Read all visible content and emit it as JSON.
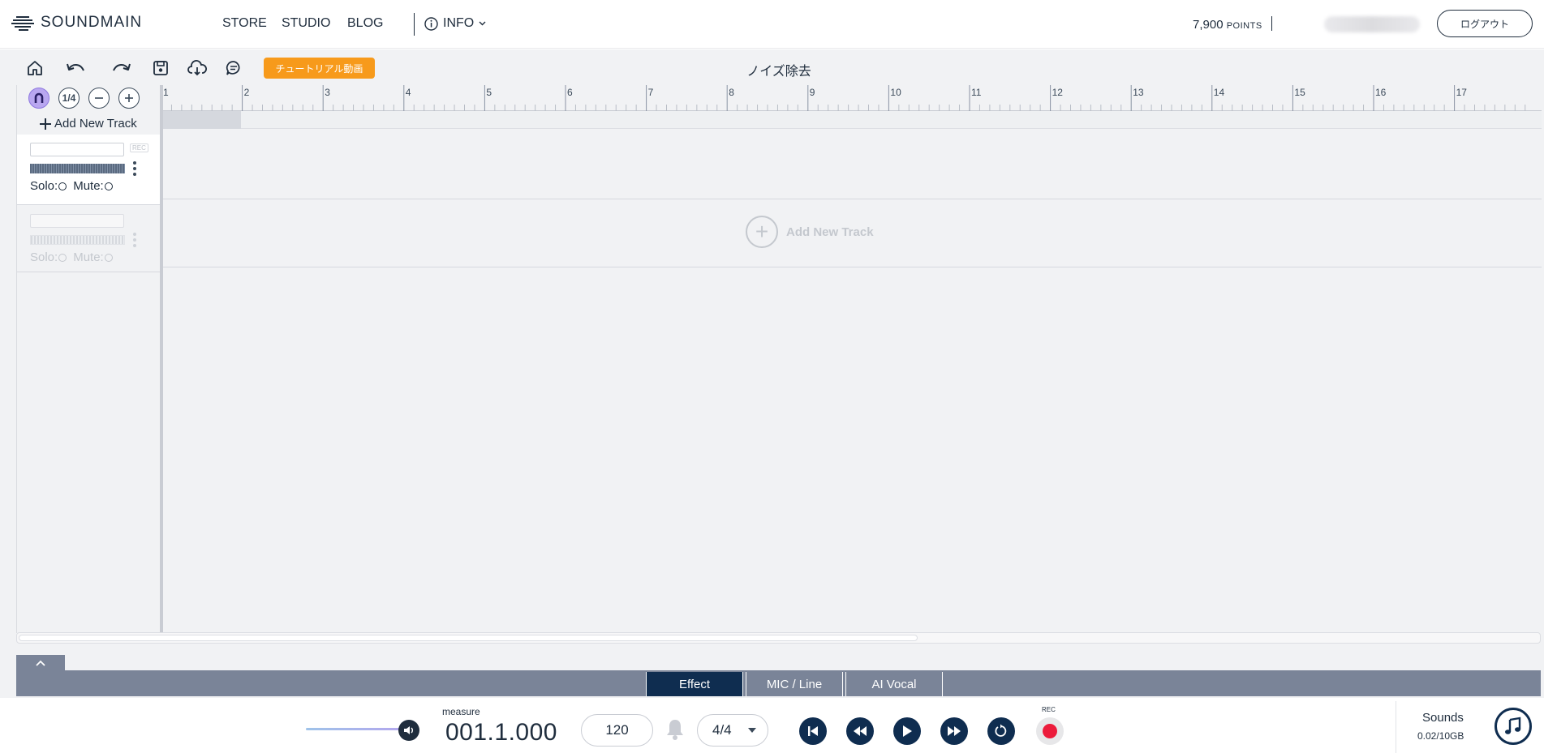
{
  "nav": {
    "logo_text": "SOUNDMAIN",
    "links": [
      "STORE",
      "STUDIO",
      "BLOG"
    ],
    "info_label": "INFO",
    "points_value": "7,900",
    "points_unit": "POINTS",
    "logout_label": "ログアウト"
  },
  "toolbar": {
    "tutorial_label": "チュートリアル動画",
    "project_title": "ノイズ除去",
    "icons": [
      "home-icon",
      "undo-icon",
      "redo-icon",
      "save-icon",
      "cloud-download-icon",
      "comment-icon"
    ]
  },
  "tracks_panel": {
    "quantize_label": "1/4",
    "add_track_label": "Add New Track",
    "rec_badge": "REC",
    "solo_label": "Solo:",
    "mute_label": "Mute:"
  },
  "timeline": {
    "bar_numbers": [
      "1",
      "2",
      "3",
      "4",
      "5",
      "6",
      "7",
      "8",
      "9",
      "10",
      "11",
      "12",
      "13",
      "14",
      "15",
      "16",
      "17"
    ],
    "add_track_label": "Add New Track"
  },
  "bottom_tabs": [
    "Effect",
    "MIC / Line",
    "AI Vocal"
  ],
  "active_tab": "Effect",
  "transport": {
    "measure_label": "measure",
    "measure_value": "001.1.000",
    "tempo": "120",
    "time_signature": "4/4",
    "rec_label": "REC"
  },
  "sounds": {
    "label": "Sounds",
    "usage": "0.02/10GB"
  },
  "colors": {
    "navy": "#0f2d50",
    "accent_orange": "#f79a1b",
    "rec_red": "#ec1b3b",
    "panel_gray": "#7a8498",
    "magnet_purple": "#b9a7f0"
  }
}
